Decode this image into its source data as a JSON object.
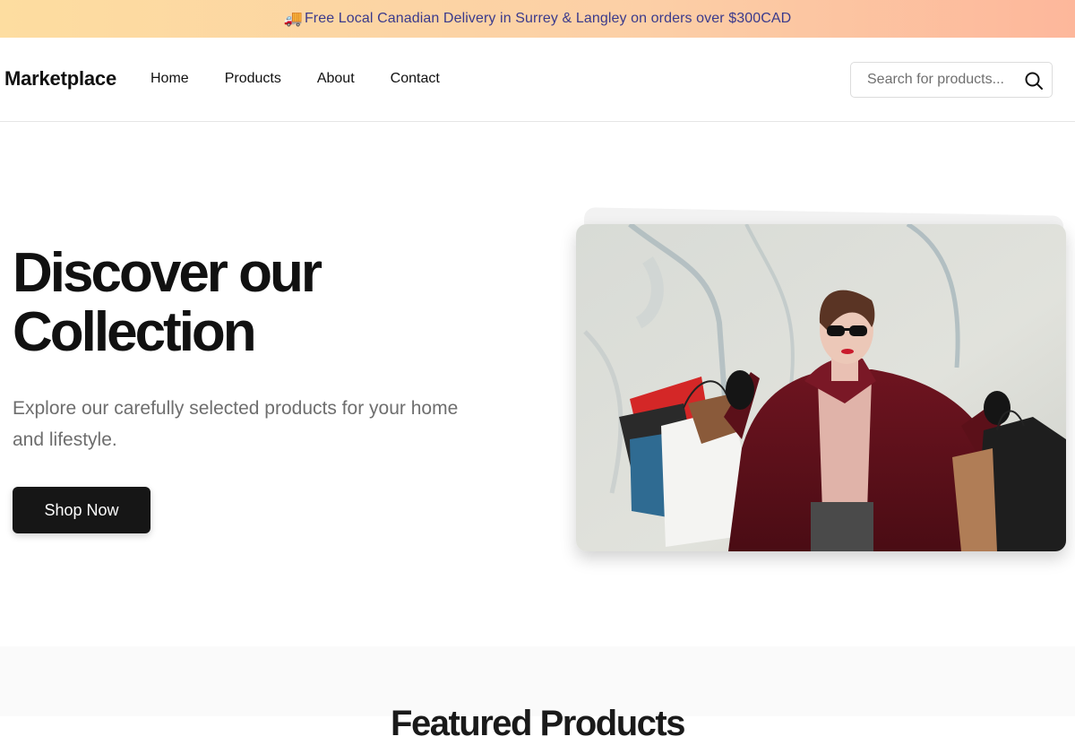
{
  "banner": {
    "icon": "delivery-truck-icon",
    "text": "Free Local Canadian Delivery in Surrey & Langley on orders over $300CAD",
    "gradient_from": "#fddda0",
    "gradient_to": "#fdb79b",
    "text_color": "#3a3a8c"
  },
  "header": {
    "logo": "Marketplace",
    "nav": [
      "Home",
      "Products",
      "About",
      "Contact"
    ],
    "search": {
      "placeholder": "Search for products...",
      "value": "",
      "icon": "search-icon"
    }
  },
  "hero": {
    "title_line1": "Discover our",
    "title_line2": "Collection",
    "subtitle": "Explore our carefully selected products for your home and lifestyle.",
    "cta": "Shop Now",
    "cta_color": "#161616",
    "image": "woman-with-shopping-bags-photo"
  },
  "next_section": {
    "heading_partial": "Featured Products"
  }
}
